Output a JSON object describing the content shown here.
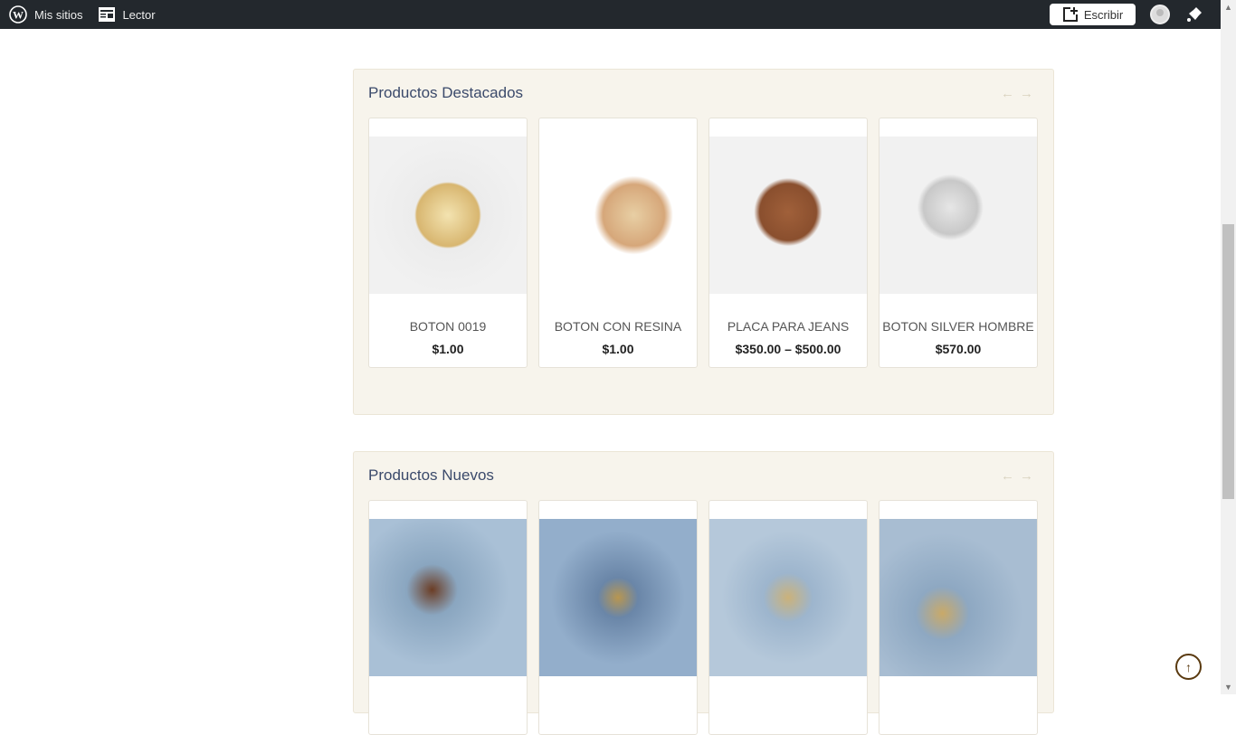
{
  "topbar": {
    "my_sites": "Mis sitios",
    "reader": "Lector",
    "write": "Escribir"
  },
  "featured": {
    "title": "Productos Destacados",
    "products": [
      {
        "name": "BOTON 0019",
        "price": "$1.00"
      },
      {
        "name": "BOTON CON RESINA",
        "price": "$1.00"
      },
      {
        "name": "PLACA PARA JEANS",
        "price": "$350.00 – $500.00"
      },
      {
        "name": "BOTON SILVER HOMBRE",
        "price": "$570.00"
      }
    ]
  },
  "new": {
    "title": "Productos Nuevos"
  }
}
